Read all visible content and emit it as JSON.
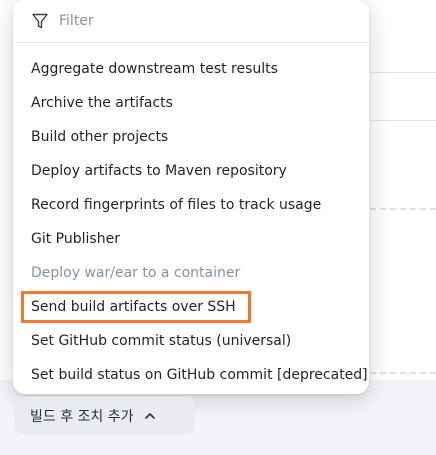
{
  "filter": {
    "placeholder": "Filter",
    "icon": "filter-icon"
  },
  "menu": {
    "items": [
      {
        "label": "Aggregate downstream test results",
        "state": "normal"
      },
      {
        "label": "Archive the artifacts",
        "state": "normal"
      },
      {
        "label": "Build other projects",
        "state": "normal"
      },
      {
        "label": "Deploy artifacts to Maven repository",
        "state": "normal"
      },
      {
        "label": "Record fingerprints of files to track usage",
        "state": "normal"
      },
      {
        "label": "Git Publisher",
        "state": "normal"
      },
      {
        "label": "Deploy war/ear to a container",
        "state": "disabled"
      },
      {
        "label": "Send build artifacts over SSH",
        "state": "highlighted"
      },
      {
        "label": "Set GitHub commit status (universal)",
        "state": "normal"
      },
      {
        "label": "Set build status on GitHub commit [deprecated]",
        "state": "normal"
      }
    ]
  },
  "footer": {
    "add_post_build_label": "빌드 후 조치 추가",
    "icon": "chevron-up-icon"
  },
  "colors": {
    "highlight_border": "#f17a2a",
    "disabled_text": "#7f93ad"
  }
}
